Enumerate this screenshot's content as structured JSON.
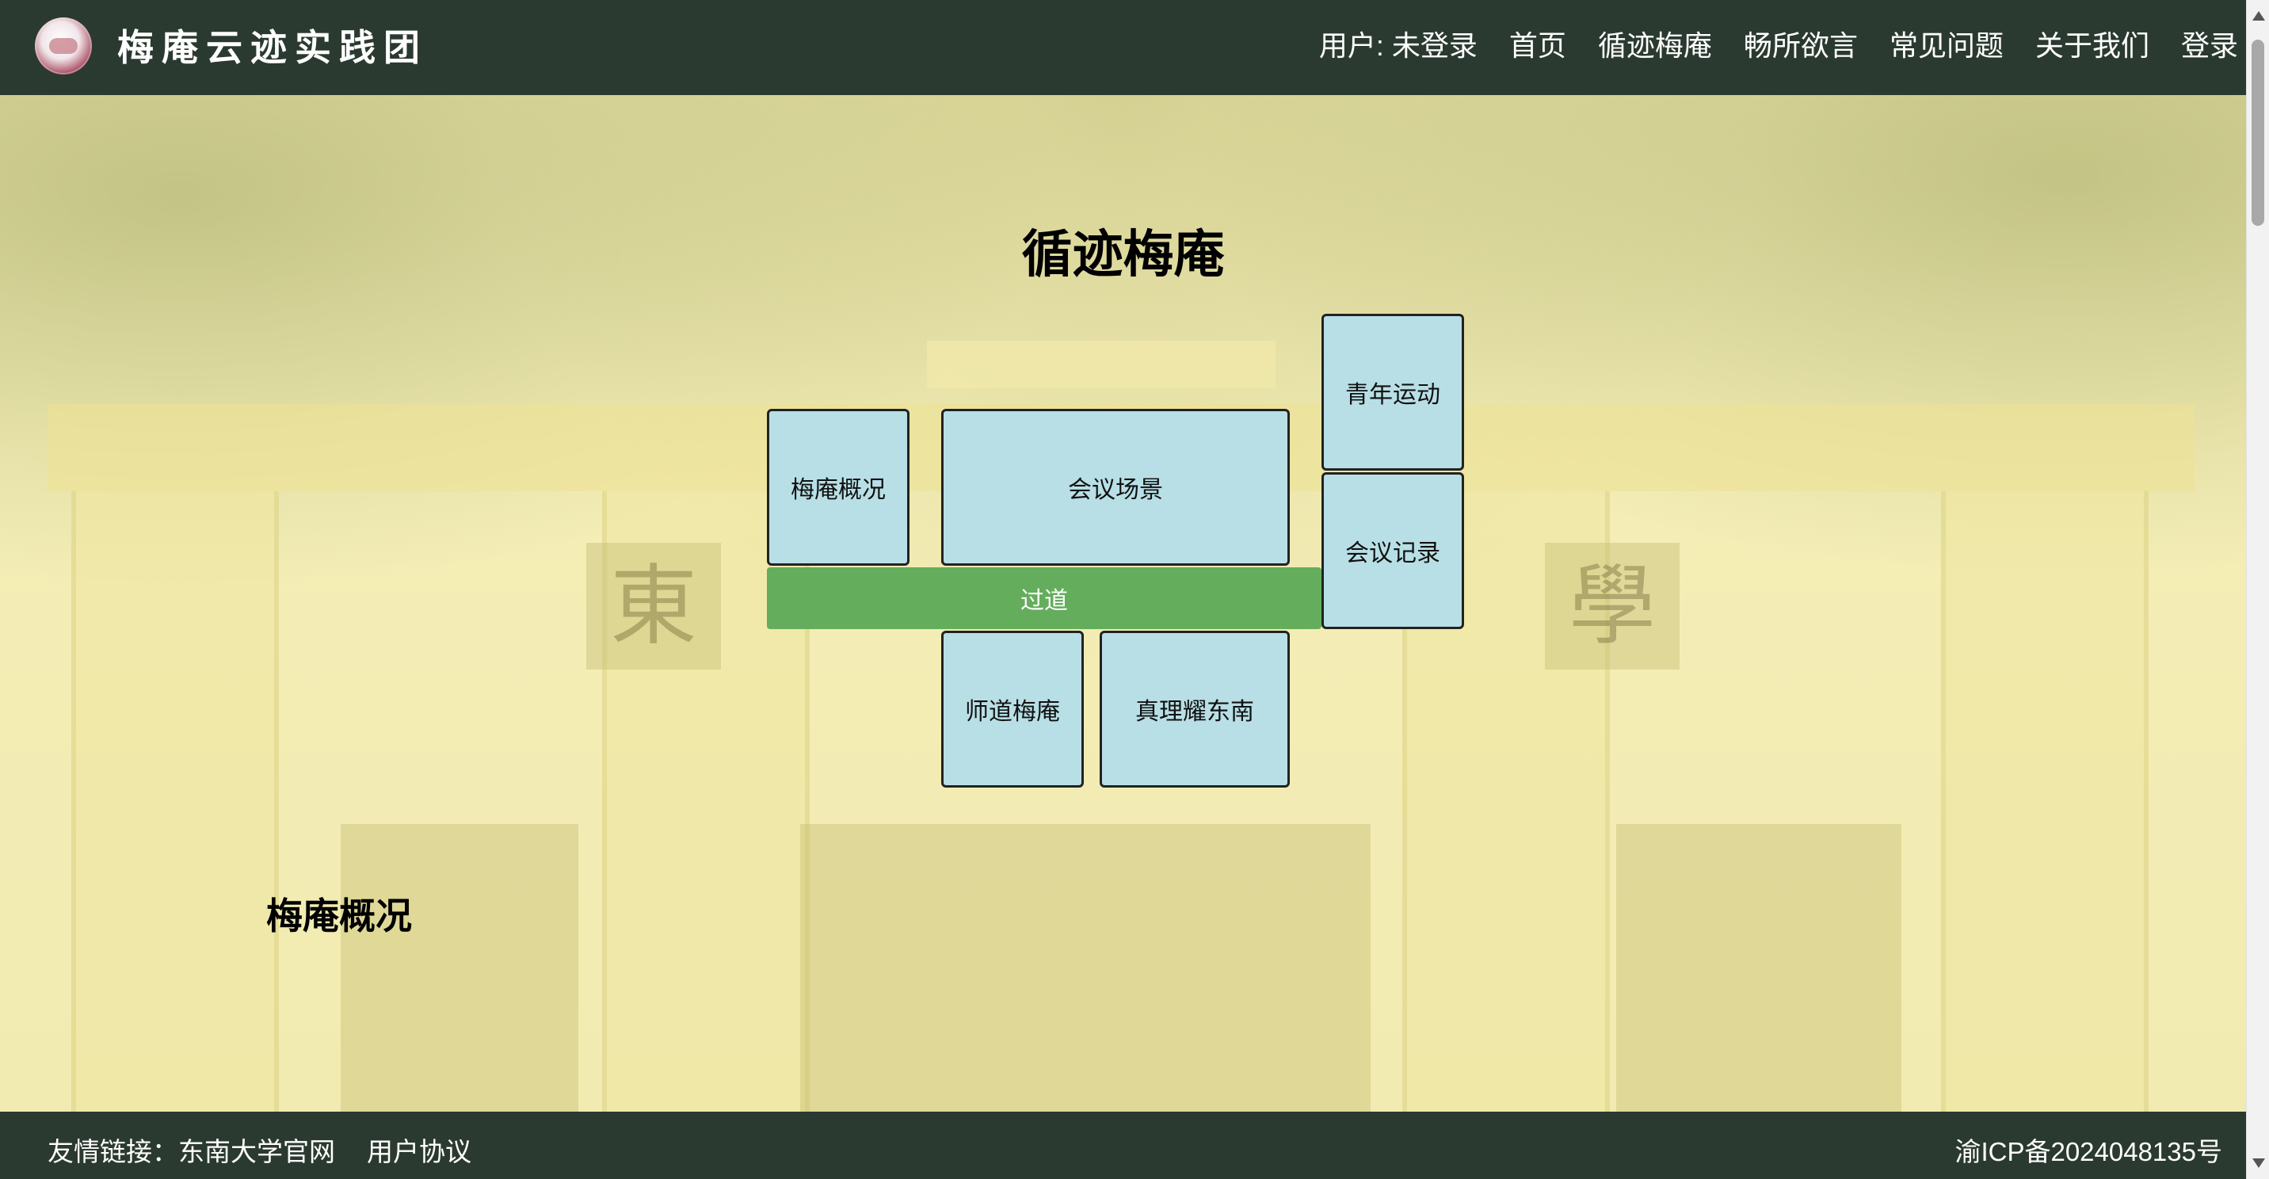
{
  "header": {
    "site_title": "梅庵云迹实践团",
    "nav": {
      "user_status": "用户: 未登录",
      "home": "首页",
      "trace": "循迹梅庵",
      "forum": "畅所欲言",
      "faq": "常见问题",
      "about": "关于我们",
      "login": "登录"
    }
  },
  "main": {
    "title": "循迹梅庵",
    "map": {
      "overview": "梅庵概况",
      "meeting_scene": "会议场景",
      "youth_movement": "青年运动",
      "meeting_record": "会议记录",
      "corridor": "过道",
      "teacher_way": "师道梅庵",
      "truth_southeast": "真理耀东南"
    },
    "section_heading": "梅庵概况"
  },
  "background": {
    "plaque_left": "東",
    "plaque_right": "學"
  },
  "footer": {
    "links_prefix": "友情链接：东南大学官网",
    "user_agreement": "用户协议",
    "icp": "渝ICP备2024048135号"
  },
  "colors": {
    "header_bg": "#2b3a30",
    "room_bg": "#b8dfe6",
    "corridor_bg": "#64ad5c",
    "page_bg": "#f3eeb8"
  }
}
